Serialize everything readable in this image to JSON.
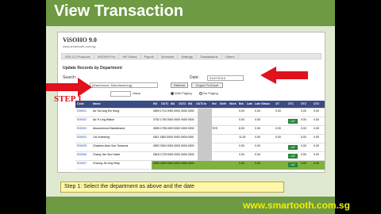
{
  "slide": {
    "title": "View Transaction",
    "step_label": "STEP 1",
    "instruction": "Step 1: Select the department as above and the date",
    "footer_url": "www.smartooth.com.sg"
  },
  "app": {
    "logo": "ViSOHO 9.0",
    "logo_url": "www.smartooth.com.sg",
    "nav": [
      "ISIS CO Products",
      "VISOHO Pro",
      "HR Suites",
      "Payroll",
      "Schedule",
      "Settings",
      "Transactions",
      "Others"
    ],
    "section_title": "Update Records by Department",
    "search_label": "Search:",
    "department_value": "[Warehouse, Manufacturing]",
    "date_label": "Date:",
    "date_value": "01/07/2013",
    "refresh_label": "Refresh",
    "export_label": "Export To Excel",
    "value_label": "Value",
    "radio_options": [
      "With Paging",
      "No Paging"
    ],
    "radio_selected": "With Paging"
  },
  "table": {
    "columns": [
      "Code",
      "Name",
      "IN1",
      "OUT1",
      "IN2",
      "OUT2",
      "IN3",
      "OUT3",
      "In",
      "Hol",
      "Shift",
      "Work",
      "Brk",
      "Late",
      "Late Status",
      "OT",
      "OT1",
      "OT2",
      "OT3"
    ],
    "rows": [
      {
        "code": "E00001",
        "name": "Ad Ton Ang Kin Hong",
        "time": "0809 1712 0000 0000 0000 0000",
        "hol": "",
        "work": "0.00",
        "late": "0.00",
        "status": "",
        "ot1": "0.00",
        "badge": "",
        "ot2": "0.00",
        "ot3": "0.00"
      },
      {
        "code": "E00002",
        "name": "Ad Yi Ling Wilson",
        "time": "0752 1750 0000 0000 0000 0000",
        "hol": "",
        "work": "0.00",
        "late": "0.00",
        "status": "",
        "ot1": "0.00",
        "badge": "LAT",
        "ot2": "0.00",
        "ot3": "0.00"
      },
      {
        "code": "E00003",
        "name": "Aboomemoni Mamikinami",
        "time": "0805 1755 0000 0000 0000 0000",
        "hol": "YES",
        "work": "8.00",
        "late": "0.00",
        "status": "",
        "ot1": "0.00",
        "badge": "",
        "ot2": "0.00",
        "ot3": "0.00"
      },
      {
        "code": "E00004",
        "name": "Cai Xuanning",
        "time": "0811 1800 0000 0000 0000 0000",
        "hol": "",
        "work": "11.00",
        "late": "0.00",
        "status": "",
        "ot1": "0.00",
        "badge": "",
        "ot2": "0.00",
        "ot3": "0.00"
      },
      {
        "code": "E00005",
        "name": "Chambro Aloe Son Tomsons",
        "time": "0802 0000 0000 0000 0000 0000",
        "hol": "",
        "work": "0.00",
        "late": "0.00",
        "status": "",
        "ot1": "0.00",
        "badge": "LAT",
        "ot2": "0.00",
        "ot3": "0.00"
      },
      {
        "code": "E00006",
        "name": "Cheng Yee Soo Hwee",
        "time": "0818 1729 0000 0000 0000 0000",
        "hol": "",
        "work": "0.00",
        "late": "0.00",
        "status": "",
        "ot1": "0.00",
        "badge": "LAT",
        "ot2": "0.00",
        "ot3": "0.00"
      },
      {
        "code": "E00007",
        "name": "Cheong Jie Ung Resy",
        "time": "0800 1800 0000 0000 0000 0000",
        "hol": "",
        "work": "0.00",
        "late": "0.00",
        "status": "",
        "ot1": "0.00",
        "badge": "LAT",
        "ot2": "0.00",
        "ot3": "0.00"
      }
    ]
  },
  "colors": {
    "slide_bg": "#dfe9cf",
    "band": "#6e9a43",
    "table_header": "#3b4b83",
    "highlight_row": "#7fb33d",
    "arrow": "#e0121b"
  }
}
